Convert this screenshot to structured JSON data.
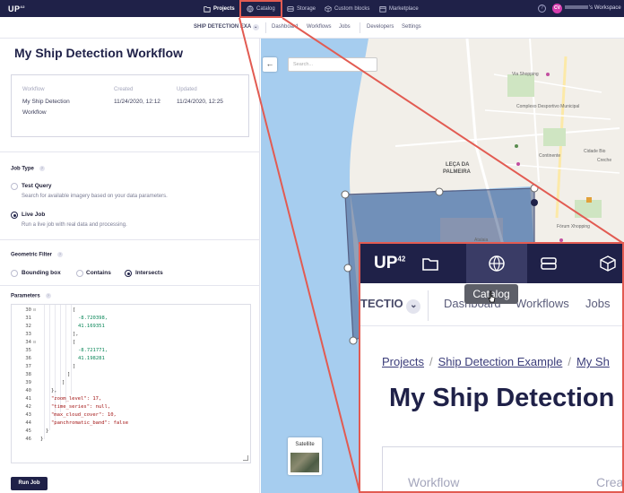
{
  "nav": {
    "logo": "UP",
    "logo_sup": "42",
    "items": [
      {
        "label": "Projects",
        "icon": "folder-icon",
        "active": true
      },
      {
        "label": "Catalog",
        "icon": "globe-icon",
        "active": false
      },
      {
        "label": "Storage",
        "icon": "storage-icon",
        "active": false
      },
      {
        "label": "Custom blocks",
        "icon": "cube-icon",
        "active": false
      },
      {
        "label": "Marketplace",
        "icon": "store-icon",
        "active": false
      }
    ],
    "help": "?",
    "avatar": "CV",
    "workspace": "'s Workspace"
  },
  "subnav": {
    "project": "SHIP DETECTION EXA",
    "tabs": [
      "Dashboard",
      "Workflows",
      "Jobs",
      "Developers",
      "Settings"
    ]
  },
  "workflow": {
    "title": "My Ship Detection Workflow",
    "headers": [
      "Workflow",
      "Created",
      "Updated"
    ],
    "values": [
      "My Ship Detection Workflow",
      "11/24/2020, 12:12",
      "11/24/2020, 12:25"
    ]
  },
  "job_type": {
    "label": "Job Type",
    "options": [
      {
        "label": "Test Query",
        "desc": "Search for available imagery based on your data parameters.",
        "selected": false
      },
      {
        "label": "Live Job",
        "desc": "Run a live job with real data and processing.",
        "selected": true
      }
    ]
  },
  "geo_filter": {
    "label": "Geometric Filter",
    "options": [
      {
        "label": "Bounding box",
        "selected": false
      },
      {
        "label": "Contains",
        "selected": false
      },
      {
        "label": "Intersects",
        "selected": true
      }
    ]
  },
  "parameters": {
    "label": "Parameters",
    "line_numbers": [
      "30",
      "31",
      "32",
      "33",
      "34",
      "35",
      "36",
      "37",
      "38",
      "39",
      "40",
      "41",
      "42",
      "43",
      "44",
      "45",
      "46"
    ],
    "lines": [
      "[",
      "-8.720398,",
      "41.169351",
      "],",
      "[",
      "-8.721771,",
      "41.198281",
      "]",
      "]",
      "]",
      "},",
      "\"zoom_level\": 17,",
      "\"time_series\": null,",
      "\"max_cloud_cover\": 10,",
      "\"panchromatic_band\": false",
      "}",
      "}"
    ]
  },
  "run_button": "Run Job",
  "map": {
    "search_placeholder": "Search...",
    "back": "←",
    "satellite": "Satellite",
    "place_leca": "LEÇA DA",
    "place_palmeira": "PALMEIRA",
    "labels": [
      "Via Shopping",
      "Complexo Desportivo Municipal",
      "Continente",
      "Cidade Bio",
      "Fórum Xhopping",
      "Atalaia",
      "Creche"
    ]
  },
  "zoom": {
    "logo": "UP",
    "logo_sup": "42",
    "tooltip": "Catalog",
    "project": "TECTIO",
    "tabs": [
      "Dashboard",
      "Workflows",
      "Jobs"
    ],
    "crumbs": [
      "Projects",
      "Ship Detection Example",
      "My Sh"
    ],
    "title": "My Ship Detection",
    "box_headers": [
      "Workflow",
      "Crea"
    ]
  }
}
